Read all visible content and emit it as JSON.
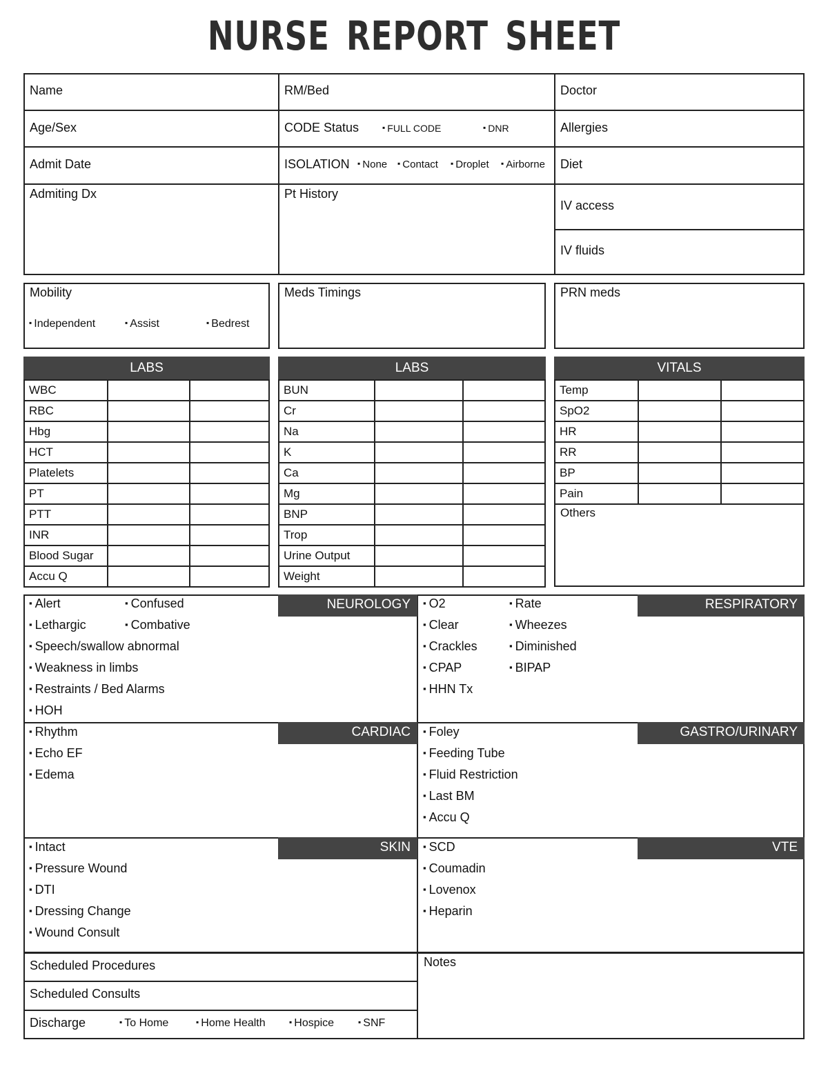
{
  "title": "NURSE REPORT SHEET",
  "patient_info": {
    "name": "Name",
    "rm_bed": "RM/Bed",
    "doctor": "Doctor",
    "age_sex": "Age/Sex",
    "code_status": "CODE Status",
    "code_options": [
      "FULL CODE",
      "DNR"
    ],
    "allergies": "Allergies",
    "admit_date": "Admit Date",
    "isolation": "ISOLATION",
    "isolation_options": [
      "None",
      "Contact",
      "Droplet",
      "Airborne"
    ],
    "diet": "Diet",
    "admitting_dx": "Admiting Dx",
    "pt_history": "Pt History",
    "iv_access": "IV access",
    "iv_fluids": "IV fluids"
  },
  "mobility": {
    "label": "Mobility",
    "options": [
      "Independent",
      "Assist",
      "Bedrest"
    ]
  },
  "meds_timings": "Meds Timings",
  "prn_meds": "PRN meds",
  "labs1": {
    "header": "LABS",
    "rows": [
      "WBC",
      "RBC",
      "Hbg",
      "HCT",
      "Platelets",
      "PT",
      "PTT",
      "INR",
      "Blood Sugar",
      "Accu Q"
    ]
  },
  "labs2": {
    "header": "LABS",
    "rows": [
      "BUN",
      "Cr",
      "Na",
      "K",
      "Ca",
      "Mg",
      "BNP",
      "Trop",
      "Urine Output",
      "Weight"
    ]
  },
  "vitals": {
    "header": "VITALS",
    "rows": [
      "Temp",
      "SpO2",
      "HR",
      "RR",
      "BP",
      "Pain"
    ],
    "others": "Others"
  },
  "neurology": {
    "header": "NEUROLOGY",
    "items": [
      "Alert",
      "Confused",
      "Lethargic",
      "Combative",
      "Speech/swallow abnormal",
      "Weakness in limbs",
      "Restraints / Bed Alarms",
      "HOH"
    ]
  },
  "respiratory": {
    "header": "RESPIRATORY",
    "items": [
      "O2",
      "Rate",
      "Clear",
      "Wheezes",
      "Crackles",
      "Diminished",
      "CPAP",
      "BIPAP",
      "HHN Tx"
    ]
  },
  "cardiac": {
    "header": "CARDIAC",
    "items": [
      "Rhythm",
      "Echo EF",
      "Edema"
    ]
  },
  "gastro": {
    "header": "GASTRO/URINARY",
    "items": [
      "Foley",
      "Feeding Tube",
      "Fluid Restriction",
      "Last BM",
      "Accu Q"
    ]
  },
  "skin": {
    "header": "SKIN",
    "items": [
      "Intact",
      "Pressure Wound",
      "DTI",
      "Dressing Change",
      "Wound Consult"
    ]
  },
  "vte": {
    "header": "VTE",
    "items": [
      "SCD",
      "Coumadin",
      "Lovenox",
      "Heparin"
    ]
  },
  "bottom": {
    "scheduled_procedures": "Scheduled Procedures",
    "scheduled_consults": "Scheduled Consults",
    "discharge": "Discharge",
    "discharge_options": [
      "To Home",
      "Home Health",
      "Hospice",
      "SNF"
    ],
    "notes": "Notes"
  }
}
